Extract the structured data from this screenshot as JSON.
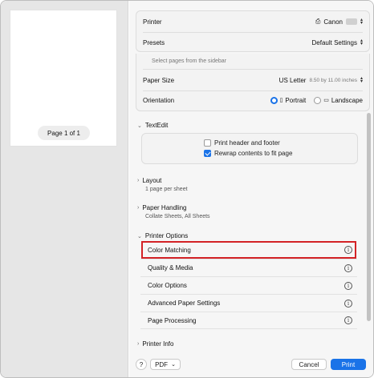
{
  "sidebar": {
    "page_indicator": "Page 1 of 1"
  },
  "settings": {
    "printer_label": "Printer",
    "printer_value": "Canon",
    "presets_label": "Presets",
    "presets_value": "Default Settings",
    "select_pages_hint": "Select pages from the sidebar",
    "paper_size_label": "Paper Size",
    "paper_size_value": "US Letter",
    "paper_size_dims": "8.50 by 11.00 inches",
    "orientation_label": "Orientation",
    "orientation_portrait": "Portrait",
    "orientation_landscape": "Landscape"
  },
  "textedit": {
    "header": "TextEdit",
    "print_header_footer": "Print header and footer",
    "rewrap": "Rewrap contents to fit page"
  },
  "layout": {
    "header": "Layout",
    "sub": "1 page per sheet"
  },
  "paper_handling": {
    "header": "Paper Handling",
    "sub": "Collate Sheets, All Sheets"
  },
  "printer_options": {
    "header": "Printer Options",
    "items": [
      {
        "label": "Color Matching"
      },
      {
        "label": "Quality & Media"
      },
      {
        "label": "Color Options"
      },
      {
        "label": "Advanced Paper Settings"
      },
      {
        "label": "Page Processing"
      }
    ]
  },
  "printer_info": {
    "header": "Printer Info"
  },
  "footer": {
    "help": "?",
    "pdf": "PDF",
    "cancel": "Cancel",
    "print": "Print"
  },
  "colors": {
    "accent": "#1a73e8",
    "highlight": "#d32226"
  }
}
